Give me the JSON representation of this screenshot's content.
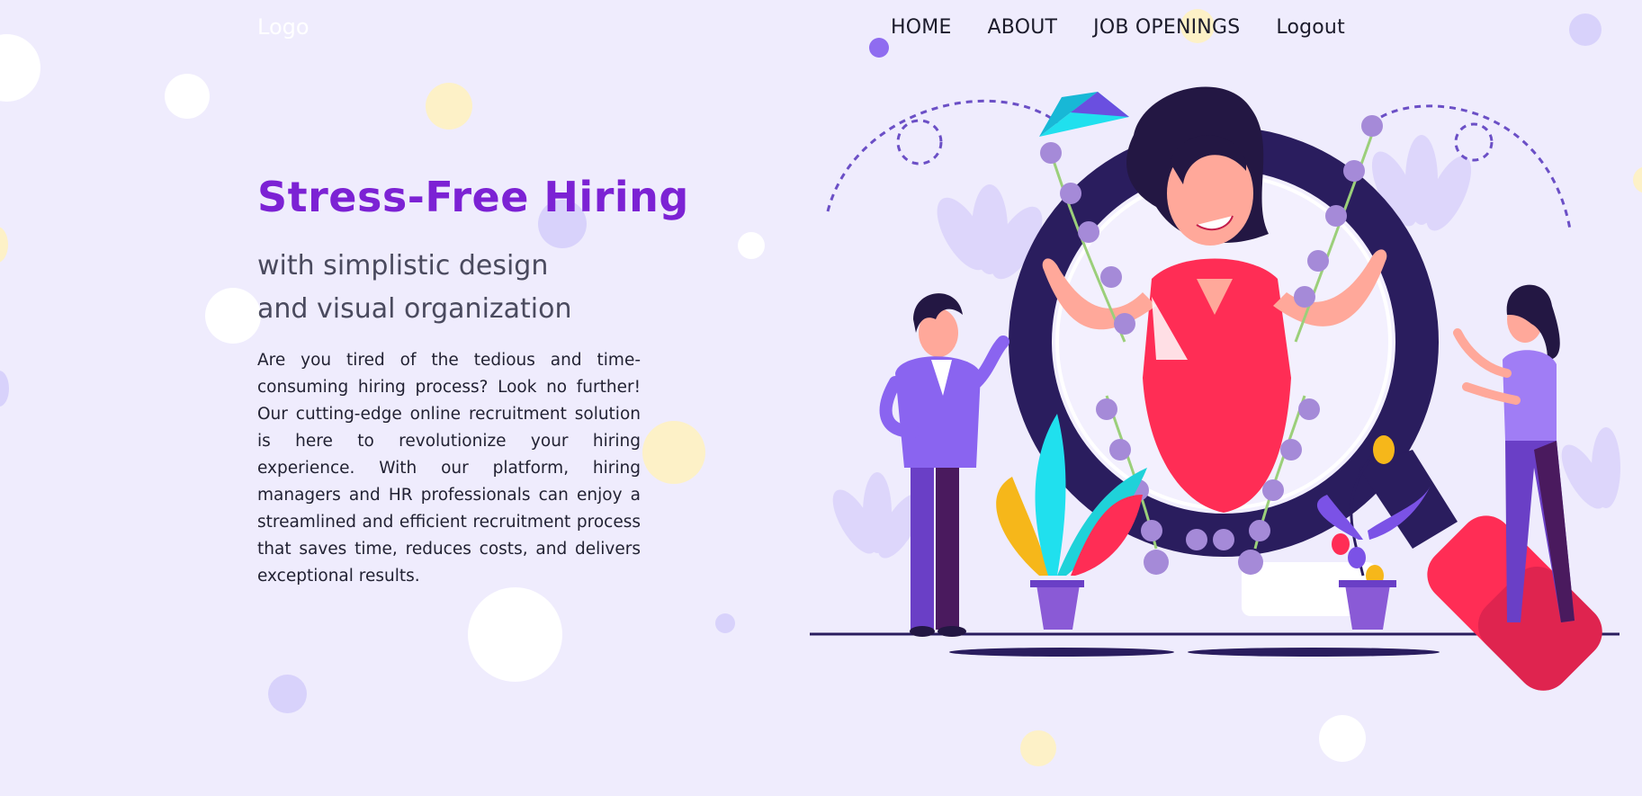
{
  "header": {
    "logo": "Logo",
    "nav": [
      {
        "label": "HOME"
      },
      {
        "label": "ABOUT"
      },
      {
        "label": "JOB OPENINGS"
      },
      {
        "label": "Logout"
      }
    ]
  },
  "hero": {
    "title": "Stress-Free Hiring",
    "subtitle_line1": "with simplistic design",
    "subtitle_line2": "and visual organization",
    "body": "Are you tired of the tedious and time-consuming hiring process? Look no further! Our cutting-edge online recruitment solution is here to revolutionize your hiring experience. With our platform, hiring managers and HR professionals can enjoy a streamlined and efficient recruitment process that saves time, reduces costs, and delivers exceptional results."
  },
  "colors": {
    "background": "#efecfd",
    "accent_purple": "#7c22d4",
    "magnifier_pink": "#ff2d55",
    "magnifier_ring": "#2a1d5e"
  },
  "illustration": {
    "icons": [
      "magnifying-glass",
      "woman-figure",
      "man-figure",
      "paper-plane",
      "flower-pots"
    ]
  }
}
